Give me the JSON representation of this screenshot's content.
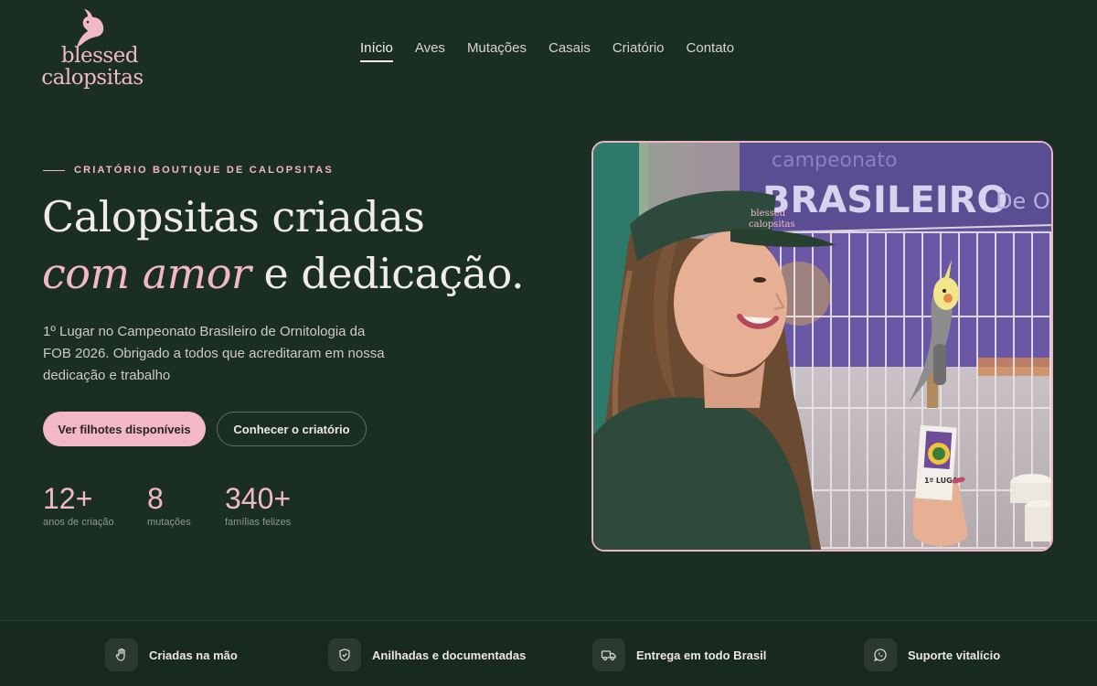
{
  "brand": {
    "line1": "blessed",
    "line2": "calopsitas"
  },
  "nav": {
    "items": [
      "Início",
      "Aves",
      "Mutações",
      "Casais",
      "Criatório",
      "Contato"
    ],
    "active": "Início"
  },
  "hero": {
    "eyebrow": "CRIATÓRIO BOUTIQUE DE CALOPSITAS",
    "title_line1": "Calopsitas criadas",
    "title_accent": "com amor",
    "title_rest": " e dedicação.",
    "lead": "1º Lugar no Campeonato Brasileiro de Ornitologia da FOB 2026. Obrigado a todos que acreditaram em nossa dedicação e trabalho",
    "primary_button": "Ver filhotes disponíveis",
    "secondary_button": "Conhecer o criatório"
  },
  "stats": [
    {
      "value": "12+",
      "label": "anos de criação"
    },
    {
      "value": "8",
      "label": "mutações"
    },
    {
      "value": "340+",
      "label": "famílias felizes"
    }
  ],
  "photo": {
    "banner_top": "campeonato",
    "banner_main": "BRASILEIRO",
    "banner_right": "De O",
    "visor_text_1": "blessed",
    "visor_text_2": "calopsitas",
    "ribbon_text": "1º LUGA"
  },
  "features": [
    {
      "icon": "hand-icon",
      "label": "Criadas na mão"
    },
    {
      "icon": "shield-check-icon",
      "label": "Anilhadas e documentadas"
    },
    {
      "icon": "truck-icon",
      "label": "Entrega em todo Brasil"
    },
    {
      "icon": "whatsapp-icon",
      "label": "Suporte vitalício"
    }
  ],
  "colors": {
    "background": "#1b2e24",
    "accent_pink": "#f1b8c7",
    "text_light": "#f1ece4"
  }
}
